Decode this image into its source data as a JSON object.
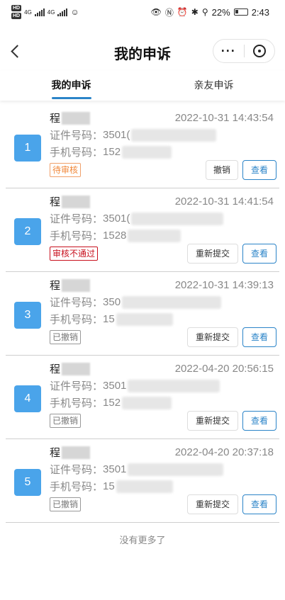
{
  "status_bar": {
    "hd1": "HD",
    "hd2": "HD",
    "net1": "4G",
    "net2": "4G",
    "battery": "22%",
    "time": "2:43"
  },
  "nav": {
    "title": "我的申诉",
    "more": "···"
  },
  "tabs": [
    {
      "label": "我的申诉",
      "active": true
    },
    {
      "label": "亲友申诉",
      "active": false
    }
  ],
  "field_labels": {
    "id": "证件号码：",
    "phone": "手机号码："
  },
  "items": [
    {
      "index": "1",
      "name": "程",
      "time": "2022-10-31 14:43:54",
      "id_prefix": "3501(",
      "phone_prefix": "152",
      "status": "待审核",
      "status_type": "pending",
      "secondary": "撤销",
      "view": "查看"
    },
    {
      "index": "2",
      "name": "程",
      "time": "2022-10-31 14:41:54",
      "id_prefix": "3501(",
      "phone_prefix": "1528",
      "status": "审核不通过",
      "status_type": "rejected",
      "secondary": "重新提交",
      "view": "查看"
    },
    {
      "index": "3",
      "name": "程",
      "time": "2022-10-31 14:39:13",
      "id_prefix": "350",
      "phone_prefix": "15",
      "status": "已撤销",
      "status_type": "revoked",
      "secondary": "重新提交",
      "view": "查看"
    },
    {
      "index": "4",
      "name": "程",
      "time": "2022-04-20 20:56:15",
      "id_prefix": "3501",
      "phone_prefix": "152",
      "status": "已撤销",
      "status_type": "revoked",
      "secondary": "重新提交",
      "view": "查看"
    },
    {
      "index": "5",
      "name": "程",
      "time": "2022-04-20 20:37:18",
      "id_prefix": "3501",
      "phone_prefix": "15",
      "status": "已撤销",
      "status_type": "revoked",
      "secondary": "重新提交",
      "view": "查看"
    }
  ],
  "footer": "没有更多了",
  "colors": {
    "accent": "#2b84c8",
    "number_bg": "#4aa4ea",
    "pending": "#f0883a",
    "rejected": "#c8101d"
  }
}
